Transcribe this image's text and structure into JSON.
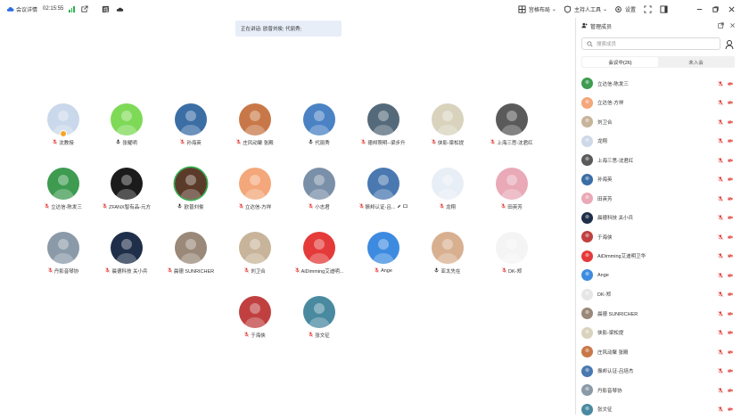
{
  "topbar": {
    "meeting_info": "会议详情",
    "elapsed": "02:15:55",
    "layout_label": "宫格布局",
    "host_tools_label": "主持人工具",
    "settings_label": "设置"
  },
  "speaking_banner": "正在讲话: 欧普刘俊; 代丽秀;",
  "tiles": [
    {
      "name": "沈教授",
      "muted": true,
      "host": true,
      "color": "#c9d8ea"
    },
    {
      "name": "张耀明",
      "muted": false,
      "color": "#7ed957"
    },
    {
      "name": "孙海英",
      "muted": true,
      "color": "#3b6ea5"
    },
    {
      "name": "庄风动聚 张殿",
      "muted": true,
      "color": "#c87848"
    },
    {
      "name": "代丽秀",
      "muted": false,
      "color": "#4a82c4"
    },
    {
      "name": "德邦照明--梁步升",
      "muted": true,
      "color": "#546a7a"
    },
    {
      "name": "侠影-梁松提",
      "muted": true,
      "color": "#d9d3be"
    },
    {
      "name": "上海三思-沈君红",
      "muted": true,
      "color": "#5a5a5a"
    },
    {
      "name": "立达信-陈发三",
      "muted": true,
      "color": "#3e9b50"
    },
    {
      "name": "ZFANX智有品-元方",
      "muted": true,
      "color": "#1b1b1b"
    },
    {
      "name": "欧普刘俊",
      "muted": false,
      "speaking": true,
      "color": "#5a3b2a"
    },
    {
      "name": "立达信-方祥",
      "muted": true,
      "color": "#f3a77a"
    },
    {
      "name": "小志君",
      "muted": true,
      "color": "#7a8fa8"
    },
    {
      "name": "振邦认证-吕...",
      "muted": true,
      "extra": true,
      "color": "#4a78b0"
    },
    {
      "name": "龙翔",
      "muted": true,
      "color": "#e8eef6"
    },
    {
      "name": "田英芳",
      "muted": true,
      "color": "#e9a9b7"
    },
    {
      "name": "丹影音琴协",
      "muted": true,
      "color": "#8a9aa8"
    },
    {
      "name": "晨德科技 关小兵",
      "muted": true,
      "color": "#1f2f4a"
    },
    {
      "name": "晨德 SUNRICHER",
      "muted": true,
      "color": "#9a8878"
    },
    {
      "name": "刘卫合",
      "muted": true,
      "color": "#c8b49a"
    },
    {
      "name": "AiDimming艾迪明...",
      "muted": true,
      "color": "#e43a3a"
    },
    {
      "name": "Ange",
      "muted": true,
      "color": "#3d8be0"
    },
    {
      "name": "亚太先在",
      "muted": false,
      "color": "#d8b090"
    },
    {
      "name": "DK-郑",
      "muted": true,
      "color": "#f4f4f4"
    },
    {
      "name": "于海侠",
      "muted": true,
      "color": "#c04040"
    },
    {
      "name": "张文征",
      "muted": true,
      "color": "#4a8aa0"
    }
  ],
  "panel": {
    "title": "管理成员",
    "search_placeholder": "搜索成员",
    "tabs": [
      "会议中(26)",
      "未入会"
    ],
    "members": [
      {
        "name": "立达信-陈发三",
        "color": "#3e9b50"
      },
      {
        "name": "立达信-方祥",
        "color": "#f3a77a"
      },
      {
        "name": "刘卫合",
        "color": "#c8b49a"
      },
      {
        "name": "龙翔",
        "color": "#cdd9e8"
      },
      {
        "name": "上海三思-沈君红",
        "color": "#5a5a5a"
      },
      {
        "name": "孙海英",
        "color": "#3b6ea5"
      },
      {
        "name": "田英芳",
        "color": "#e9a9b7"
      },
      {
        "name": "晨德科技 关小兵",
        "color": "#1f2f4a"
      },
      {
        "name": "于海侠",
        "color": "#c04040"
      },
      {
        "name": "AiDimming艾迪明卫华",
        "color": "#e43a3a"
      },
      {
        "name": "Ange",
        "color": "#3d8be0"
      },
      {
        "name": "DK-郑",
        "color": "#e6e6e6"
      },
      {
        "name": "晨德 SUNRICHER",
        "color": "#9a8878"
      },
      {
        "name": "侠影-梁松提",
        "color": "#d9d3be"
      },
      {
        "name": "庄风动聚 张殿",
        "color": "#c87848"
      },
      {
        "name": "振邦认证-吕培杰",
        "color": "#4a78b0"
      },
      {
        "name": "丹影音琴协",
        "color": "#8a9aa8"
      },
      {
        "name": "张文征",
        "color": "#4a8aa0"
      }
    ]
  }
}
